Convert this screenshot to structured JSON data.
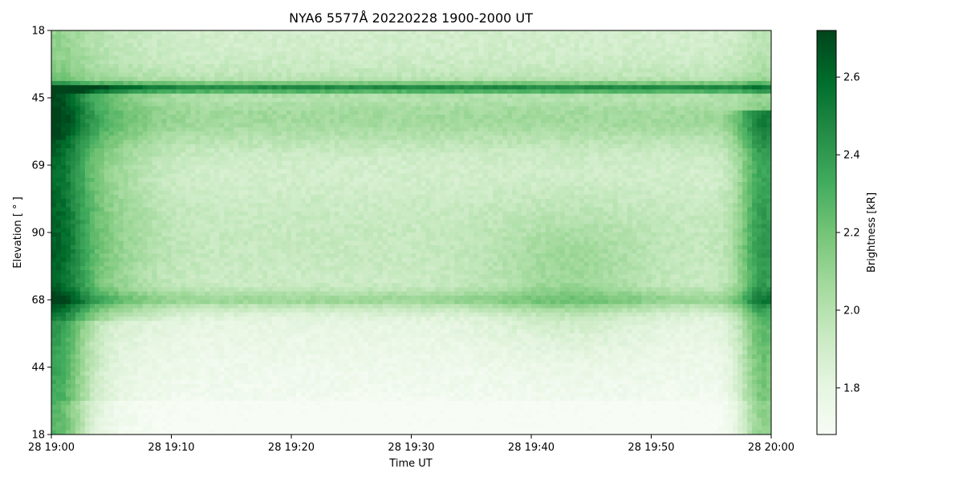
{
  "chart_data": {
    "type": "heatmap",
    "title": "NYA6 5577Å 20220228 1900-2000 UT",
    "xlabel": "Time UT",
    "ylabel": "Elevation [$^\\circ$]",
    "ylabel_display": "Elevation [ ° ]",
    "colorbar_label": "Brightness  [kR]",
    "colormap": "Greens",
    "x_ticks": [
      "28 19:00",
      "28 19:10",
      "28 19:20",
      "28 19:30",
      "28 19:40",
      "28 19:50",
      "28 20:00"
    ],
    "y_ticks": [
      "18",
      "45",
      "69",
      "90",
      "68",
      "44",
      "18"
    ],
    "colorbar_ticks": [
      1.8,
      2.0,
      2.2,
      2.4,
      2.6
    ],
    "colorbar_range": [
      1.68,
      2.72
    ],
    "x_range": [
      "19:00",
      "20:00"
    ],
    "colors": {
      "low": "#f7fcf5",
      "high": "#00441b"
    }
  }
}
